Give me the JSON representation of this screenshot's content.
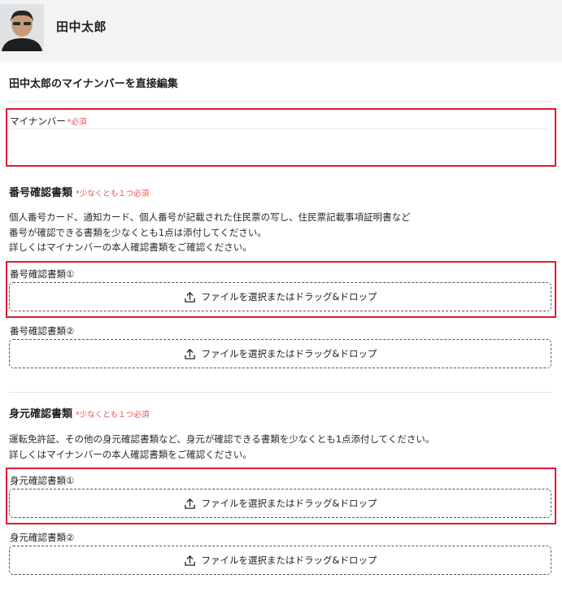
{
  "user": {
    "name": "田中太郎"
  },
  "page": {
    "title": "田中太郎のマイナンバーを直接編集"
  },
  "mynumber": {
    "label": "マイナンバー",
    "required": "*必須",
    "value": ""
  },
  "number_docs": {
    "title": "番号確認書類",
    "required": "*少なくとも１つ必須",
    "desc": [
      "個人番号カード、通知カード、個人番号が記載された住民票の写し、住民票記載事項証明書など",
      "番号が確認できる書類を少なくとも1点は添付してください。",
      "詳しくはマイナンバーの本人確認書類をご確認ください。"
    ],
    "uploads": [
      {
        "label": "番号確認書類①",
        "button": "ファイルを選択またはドラッグ&ドロップ"
      },
      {
        "label": "番号確認書類②",
        "button": "ファイルを選択またはドラッグ&ドロップ"
      }
    ]
  },
  "identity_docs": {
    "title": "身元確認書類",
    "required": "*少なくとも１つ必須",
    "desc": [
      "運転免許証、その他の身元確認書類など、身元が確認できる書類を少なくとも1点添付してください。",
      "詳しくはマイナンバーの本人確認書類をご確認ください。"
    ],
    "uploads": [
      {
        "label": "身元確認書類①",
        "button": "ファイルを選択またはドラッグ&ドロップ"
      },
      {
        "label": "身元確認書類②",
        "button": "ファイルを選択またはドラッグ&ドロップ"
      }
    ]
  },
  "colors": {
    "highlight": "#e2182d",
    "required": "#e55050",
    "header_bg": "#f3f3f3"
  },
  "icons": {
    "upload": "upload-icon"
  }
}
